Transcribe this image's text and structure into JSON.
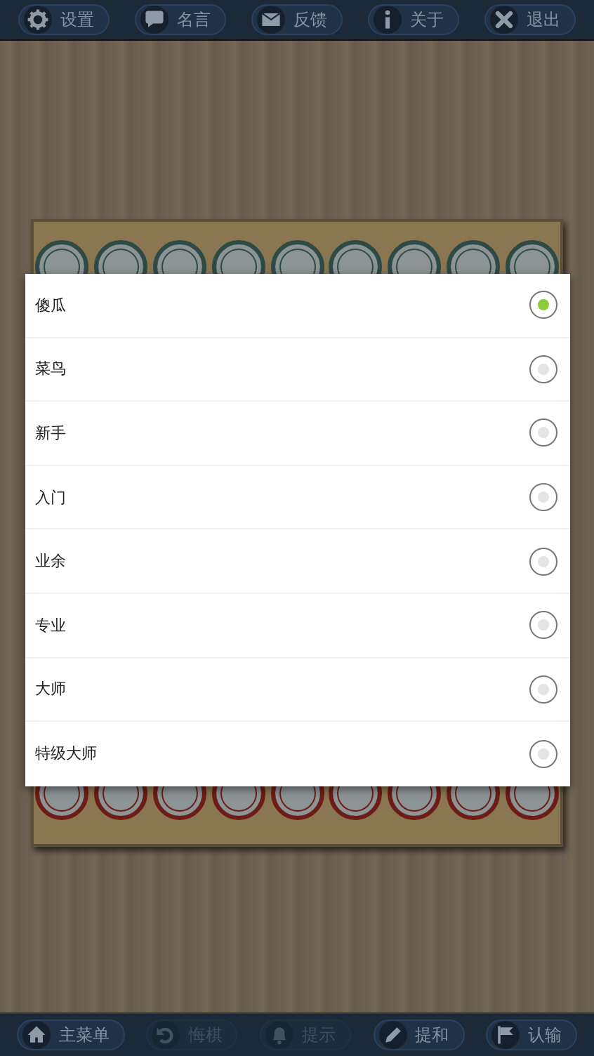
{
  "top_bar": [
    {
      "label": "设置"
    },
    {
      "label": "名言"
    },
    {
      "label": "反馈"
    },
    {
      "label": "关于"
    },
    {
      "label": "退出"
    }
  ],
  "dialog": {
    "options": [
      {
        "label": "傻瓜",
        "selected": true
      },
      {
        "label": "菜鸟",
        "selected": false
      },
      {
        "label": "新手",
        "selected": false
      },
      {
        "label": "入门",
        "selected": false
      },
      {
        "label": "业余",
        "selected": false
      },
      {
        "label": "专业",
        "selected": false
      },
      {
        "label": "大师",
        "selected": false
      },
      {
        "label": "特级大师",
        "selected": false
      }
    ]
  },
  "bottom_bar": [
    {
      "label": "主菜单",
      "disabled": false
    },
    {
      "label": "悔棋",
      "disabled": true
    },
    {
      "label": "提示",
      "disabled": true
    },
    {
      "label": "提和",
      "disabled": false
    },
    {
      "label": "认输",
      "disabled": false
    }
  ]
}
